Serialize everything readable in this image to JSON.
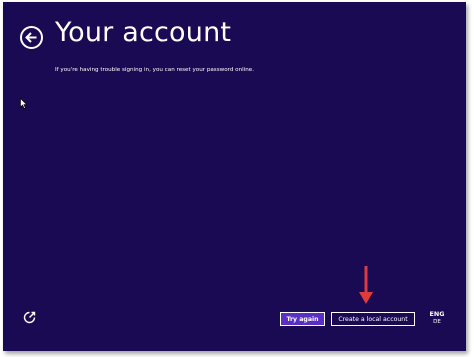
{
  "window": {
    "title": "Your account",
    "background_color": "#1a0a54"
  },
  "header": {
    "back_icon": "back-arrow-icon"
  },
  "main": {
    "help_text": "If you're having trouble signing in, you can reset your password online."
  },
  "footer": {
    "ease_of_access_icon": "ease-of-access-icon",
    "try_again_label": "Try again",
    "create_local_label": "Create a local account",
    "language": {
      "primary": "ENG",
      "secondary": "DE"
    }
  },
  "annotation": {
    "arrow_color": "#e03a3a",
    "points_to": "Create a local account"
  },
  "colors": {
    "accent_button": "#5b2ec4",
    "text": "#ffffff"
  }
}
